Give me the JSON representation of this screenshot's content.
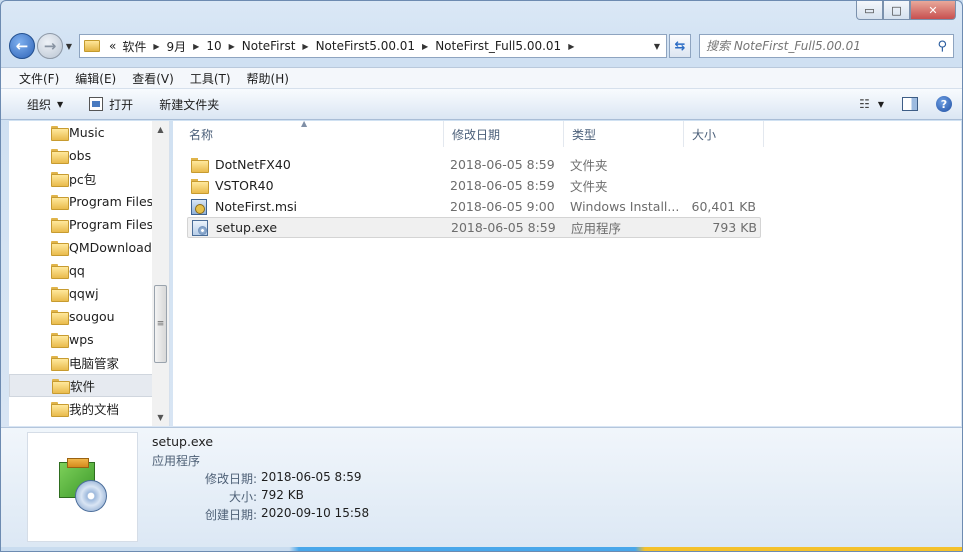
{
  "window": {
    "minimize_glyph": "▭",
    "maximize_glyph": "□",
    "close_glyph": "✕"
  },
  "navigation": {
    "back_icon": "back-arrow-icon",
    "forward_icon": "forward-arrow-icon",
    "overflow": "«",
    "breadcrumbs": [
      "软件",
      "9月",
      "10",
      "NoteFirst",
      "NoteFirst5.00.01",
      "NoteFirst_Full5.00.01"
    ],
    "search_placeholder": "搜索 NoteFirst_Full5.00.01"
  },
  "menubar": {
    "items": [
      "文件(F)",
      "编辑(E)",
      "查看(V)",
      "工具(T)",
      "帮助(H)"
    ]
  },
  "toolbar": {
    "organize": "组织",
    "open": "打开",
    "new_folder": "新建文件夹"
  },
  "sidebar": {
    "items": [
      {
        "label": "Music"
      },
      {
        "label": "obs"
      },
      {
        "label": "pc包"
      },
      {
        "label": "Program Files"
      },
      {
        "label": "Program Files"
      },
      {
        "label": "QMDownload"
      },
      {
        "label": "qq"
      },
      {
        "label": "qqwj"
      },
      {
        "label": "sougou"
      },
      {
        "label": "wps"
      },
      {
        "label": "电脑管家"
      },
      {
        "label": "软件",
        "selected": true
      },
      {
        "label": "我的文档"
      }
    ]
  },
  "file_list": {
    "columns": {
      "name": "名称",
      "date": "修改日期",
      "type": "类型",
      "size": "大小"
    },
    "rows": [
      {
        "name": "DotNetFX40",
        "date": "2018-06-05 8:59",
        "type": "文件夹",
        "size": "",
        "icon": "folder-icon"
      },
      {
        "name": "VSTOR40",
        "date": "2018-06-05 8:59",
        "type": "文件夹",
        "size": "",
        "icon": "folder-icon"
      },
      {
        "name": "NoteFirst.msi",
        "date": "2018-06-05 9:00",
        "type": "Windows Install...",
        "size": "60,401 KB",
        "icon": "msi-icon"
      },
      {
        "name": "setup.exe",
        "date": "2018-06-05 8:59",
        "type": "应用程序",
        "size": "793 KB",
        "icon": "exe-icon",
        "selected": true
      }
    ]
  },
  "details": {
    "title": "setup.exe",
    "type": "应用程序",
    "modified_label": "修改日期:",
    "modified_value": "2018-06-05 8:59",
    "size_label": "大小:",
    "size_value": "792 KB",
    "created_label": "创建日期:",
    "created_value": "2020-09-10 15:58"
  }
}
